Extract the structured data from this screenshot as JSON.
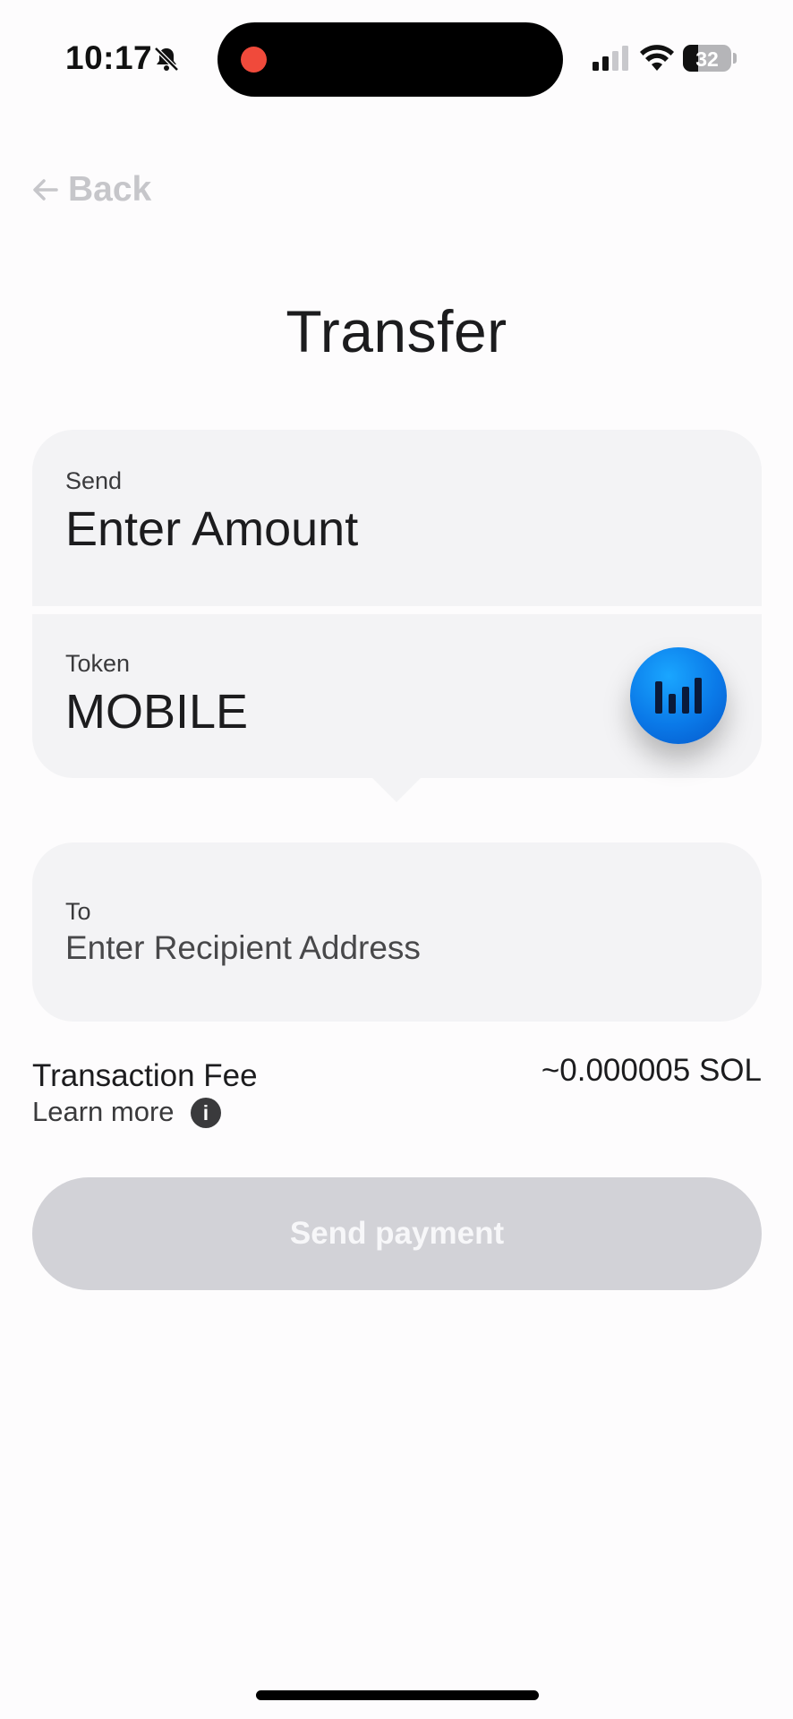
{
  "status_bar": {
    "time": "10:17",
    "battery_percent": "32",
    "battery_level": 0.32,
    "icons": [
      "bell-slash-icon",
      "recording-dot",
      "cellular-signal-icon",
      "wifi-icon",
      "battery-icon"
    ]
  },
  "nav": {
    "back_label": "Back",
    "back_icon": "arrow-left-icon"
  },
  "page": {
    "title": "Transfer"
  },
  "send_field": {
    "label": "Send",
    "placeholder": "Enter Amount"
  },
  "token_field": {
    "label": "Token",
    "value": "MOBILE",
    "icon": "mobile-token-icon"
  },
  "to_field": {
    "label": "To",
    "placeholder": "Enter Recipient Address"
  },
  "fee": {
    "label": "Transaction Fee",
    "learn_more": "Learn more",
    "info_icon": "info-icon",
    "value": "~0.000005 SOL"
  },
  "actions": {
    "send_label": "Send payment"
  },
  "colors": {
    "background": "#fdfcfd",
    "card": "#f3f3f5",
    "button_disabled": "#d2d2d7",
    "token_blue": "#0a79e8",
    "recording_red": "#f04a3b"
  }
}
